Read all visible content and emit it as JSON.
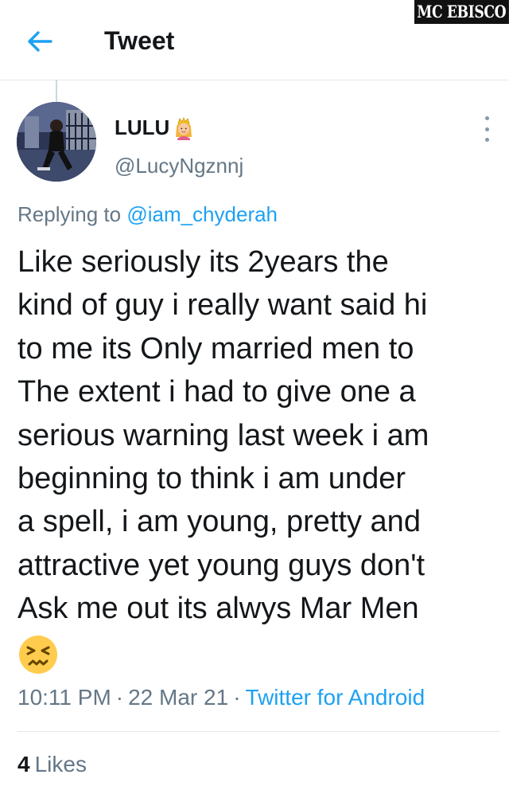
{
  "watermark": "MC EBISCO",
  "header": {
    "title": "Tweet",
    "back_icon": "arrow-left-icon"
  },
  "tweet": {
    "author": {
      "display_name": "LULU",
      "name_emoji": "princess-emoji",
      "handle": "@LucyNgznnj"
    },
    "replying_prefix": "Replying to",
    "replying_to": "@iam_chyderah",
    "text_lines": [
      "Like seriously its 2years the",
      "kind of guy i really want said hi",
      "to me its Only married men to",
      "The extent i had to give one a",
      "serious warning last week i am",
      "beginning to think i am under",
      "a spell, i am young, pretty and",
      "attractive yet young guys don't",
      "Ask me out its alwys Mar Men"
    ],
    "trailing_emoji": "persevering-face-emoji",
    "time": "10:11 PM",
    "date": "22 Mar 21",
    "source": "Twitter for Android",
    "separator": "·",
    "likes_count": "4",
    "likes_label": "Likes"
  },
  "colors": {
    "accent": "#1da1f2",
    "text_primary": "#14171a",
    "text_secondary": "#657786",
    "divider": "#e1e8ed"
  }
}
